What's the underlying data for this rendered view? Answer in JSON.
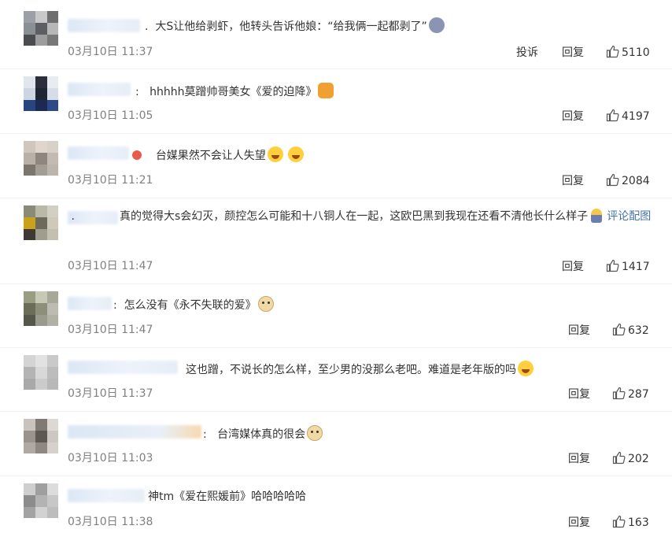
{
  "actions": {
    "report": "投诉",
    "reply": "回复"
  },
  "colors": {
    "text": "#333333",
    "time": "#808080",
    "link": "#4472a9",
    "separator": "#f2f2f2"
  },
  "comments": [
    {
      "text": "大S让他给剥虾，他转头告诉他娘：“给我俩一起都剥了”",
      "emoji": "shocked-face",
      "time": "03月10日 11:37",
      "likes": "5110"
    },
    {
      "text": "hhhhh莫蹭帅哥美女《爱的迫降》",
      "emoji": "fist",
      "time": "03月10日 11:05",
      "likes": "4197"
    },
    {
      "text": "台媒果然不会让人失望",
      "emoji": "laugh-tears x2",
      "time": "03月10日 11:21",
      "likes": "2084"
    },
    {
      "text": "真的觉得大s会幻灭，颜控怎么可能和十八铜人在一起，这欧巴黑到我现在还看不清他长什么样子",
      "link": "评论配图",
      "time": "03月10日 11:47",
      "likes": "1417"
    },
    {
      "text": "怎么没有《永不失联的爱》",
      "emoji": "doge",
      "time": "03月10日 11:47",
      "likes": "632"
    },
    {
      "text": "这也蹭，不说长的怎么样，至少男的没那么老吧。难道是老年版的吗",
      "emoji": "rolling-laugh",
      "time": "03月10日 11:37",
      "likes": "287"
    },
    {
      "text": "台湾媒体真的很会",
      "emoji": "doge",
      "time": "03月10日 11:03",
      "likes": "202"
    },
    {
      "text": "神tm《爱在熙媛前》哈哈哈哈哈",
      "time": "03月10日 11:38",
      "likes": "163"
    }
  ]
}
